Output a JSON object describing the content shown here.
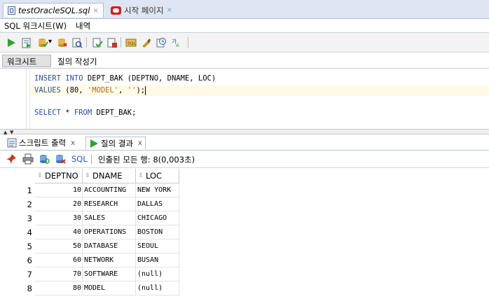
{
  "doc_tabs": {
    "active": {
      "label": "testOracleSQL.sql",
      "close": "×"
    },
    "other": {
      "label": "시작 페이지",
      "close": "×"
    }
  },
  "sub_tabs": {
    "worksheet": "SQL 워크시트(W)",
    "history": "내역"
  },
  "toolbar": {
    "icons": [
      "run-statement-icon",
      "run-script-icon",
      "commit-icon",
      "dropdown-arrow-icon",
      "rollback-icon",
      "autotrace-icon",
      "explain-plan-icon",
      "sql-tuning-icon",
      "format-icon",
      "clear-icon",
      "history-icon",
      "spell-icon"
    ],
    "dropdown": "▾"
  },
  "worksheet_tabs": {
    "worksheet": "워크시트",
    "query_builder": "질의 작성기"
  },
  "editor": {
    "line1": {
      "kw": "INSERT INTO",
      "rest": " DEPT_BAK (DEPTNO, DNAME, LOC)"
    },
    "line2": {
      "kw": "VALUES",
      "prefix": " (80, ",
      "str1": "'MODEL'",
      "mid": ", ",
      "str2": "''",
      "suffix": ");"
    },
    "line4": {
      "kw1": "SELECT",
      "mid": " * ",
      "kw2": "FROM",
      "rest": " DEPT_BAK;"
    }
  },
  "splitter": {
    "up": "▲",
    "down": "▼"
  },
  "output_tabs": {
    "script_output": {
      "label": "스크립트 출력",
      "close": "x"
    },
    "query_result": {
      "label": "질의 결과",
      "close": "x"
    }
  },
  "result_toolbar": {
    "sql_label": "SQL",
    "status": "인출된 모든 행: 8(0,003초)"
  },
  "grid": {
    "columns": [
      "DEPTNO",
      "DNAME",
      "LOC"
    ],
    "sort_glyph": "⇳",
    "rows": [
      {
        "n": "1",
        "deptno": "10",
        "dname": "ACCOUNTING",
        "loc": "NEW YORK"
      },
      {
        "n": "2",
        "deptno": "20",
        "dname": "RESEARCH",
        "loc": "DALLAS"
      },
      {
        "n": "3",
        "deptno": "30",
        "dname": "SALES",
        "loc": "CHICAGO"
      },
      {
        "n": "4",
        "deptno": "40",
        "dname": "OPERATIONS",
        "loc": "BOSTON"
      },
      {
        "n": "5",
        "deptno": "50",
        "dname": "DATABASE",
        "loc": "SEOUL"
      },
      {
        "n": "6",
        "deptno": "60",
        "dname": "NETWORK",
        "loc": "BUSAN"
      },
      {
        "n": "7",
        "deptno": "70",
        "dname": "SOFTWARE",
        "loc": "(null)"
      },
      {
        "n": "8",
        "deptno": "80",
        "dname": "MODEL",
        "loc": "(null)"
      }
    ]
  },
  "colors": {
    "accent": "#2b56b5",
    "tab_strip": "#dde6f2",
    "keyword": "#2a4f9b",
    "string": "#b06b13",
    "current_line": "#fffbe6"
  }
}
